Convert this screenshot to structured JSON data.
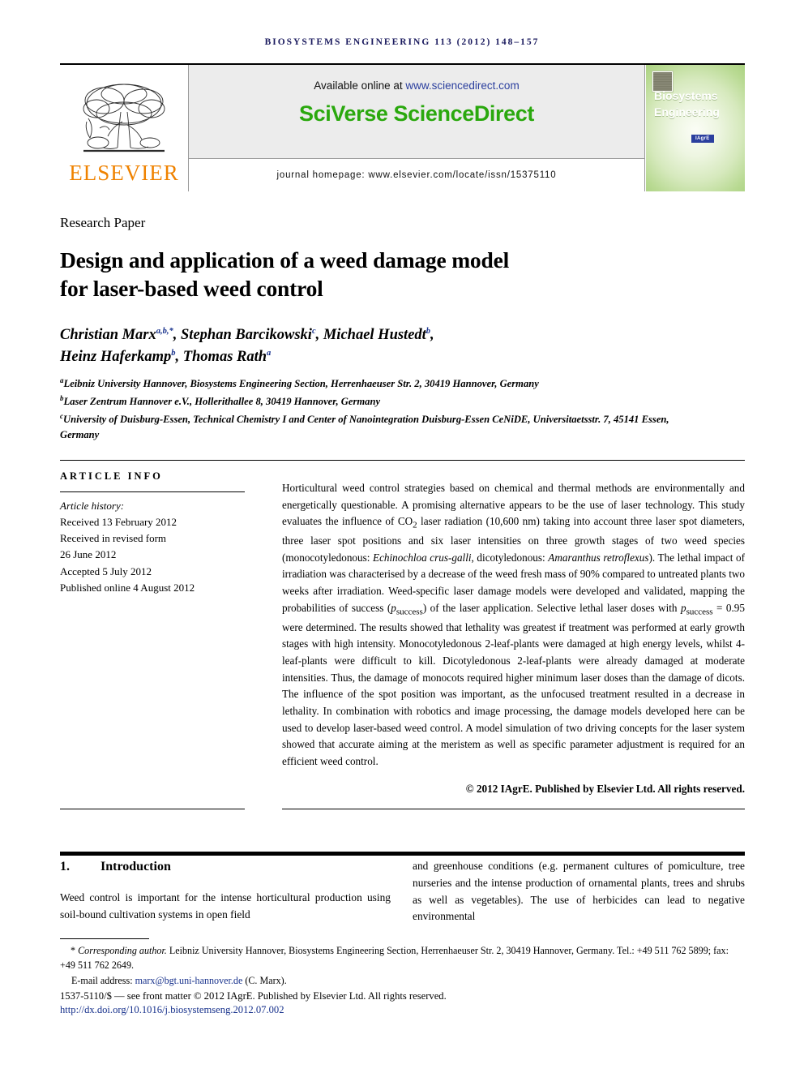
{
  "running_head": "BIOSYSTEMS ENGINEERING 113 (2012) 148–157",
  "masthead": {
    "available_prefix": "Available online at ",
    "sciencedirect_url": "www.sciencedirect.com",
    "brand": "SciVerse ScienceDirect",
    "journal_homepage": "journal homepage: www.elsevier.com/locate/issn/15375110",
    "publisher_name": "ELSEVIER",
    "cover": {
      "title_line1": "Biosystems",
      "title_line2": "Engineering",
      "badge": "IAgrE"
    },
    "colors": {
      "sciverse_green": "#2aa80e",
      "elsevier_orange": "#ef8200",
      "link_blue": "#2b3f9e",
      "banner_grey": "#ececec"
    }
  },
  "article": {
    "section_label": "Research Paper",
    "title_line1": "Design and application of a weed damage model",
    "title_line2": "for laser-based weed control",
    "authors_line1": "Christian Marx",
    "authors_line1_sup1": "a,b,*",
    "authors_line1_b": ", Stephan Barcikowski",
    "authors_line1_sup2": "c",
    "authors_line1_c": ", Michael Hustedt",
    "authors_line1_sup3": "b",
    "authors_line1_d": ",",
    "authors_line2": "Heinz Haferkamp",
    "authors_line2_sup1": "b",
    "authors_line2_b": ", Thomas Rath",
    "authors_line2_sup2": "a",
    "affiliations": [
      {
        "marker": "a",
        "text": "Leibniz University Hannover, Biosystems Engineering Section, Herrenhaeuser Str. 2, 30419 Hannover, Germany"
      },
      {
        "marker": "b",
        "text": "Laser Zentrum Hannover e.V., Hollerithallee 8, 30419 Hannover, Germany"
      },
      {
        "marker": "c",
        "text": "University of Duisburg-Essen, Technical Chemistry I and Center of Nanointegration Duisburg-Essen CeNiDE, Universitaetsstr. 7, 45141 Essen, Germany"
      }
    ]
  },
  "article_info": {
    "heading": "ARTICLE INFO",
    "history_label": "Article history:",
    "history": [
      "Received 13 February 2012",
      "Received in revised form",
      "26 June 2012",
      "Accepted 5 July 2012",
      "Published online 4 August 2012"
    ]
  },
  "abstract": {
    "part1": "Horticultural weed control strategies based on chemical and thermal methods are environmentally and energetically questionable. A promising alternative appears to be the use of laser technology. This study evaluates the influence of CO",
    "co2_sub": "2",
    "part2": " laser radiation (10,600 nm) taking into account three laser spot diameters, three laser spot positions and six laser intensities on three growth stages of two weed species (monocotyledonous: ",
    "species1": "Echinochloa crus-galli",
    "part3": ", dicotyledonous: ",
    "species2": "Amaranthus retroflexus",
    "part4": "). The lethal impact of irradiation was characterised by a decrease of the weed fresh mass of 90% compared to untreated plants two weeks after irradiation. Weed-specific laser damage models were developed and validated, mapping the probabilities of success (",
    "p_symbol1": "p",
    "p_sub1": "success",
    "part5": ") of the laser application. Selective lethal laser doses with ",
    "p_symbol2": "p",
    "p_sub2": "success",
    "part6": " = 0.95 were determined. The results showed that lethality was greatest if treatment was performed at early growth stages with high intensity. Monocotyledonous 2-leaf-plants were damaged at high energy levels, whilst 4-leaf-plants were difficult to kill. Dicotyledonous 2-leaf-plants were already damaged at moderate intensities. Thus, the damage of monocots required higher minimum laser doses than the damage of dicots. The influence of the spot position was important, as the unfocused treatment resulted in a decrease in lethality. In combination with robotics and image processing, the damage models developed here can be used to develop laser-based weed control. A model simulation of two driving concepts for the laser system showed that accurate aiming at the meristem as well as specific parameter adjustment is required for an efficient weed control.",
    "copyright": "© 2012 IAgrE. Published by Elsevier Ltd. All rights reserved."
  },
  "introduction": {
    "number": "1.",
    "heading": "Introduction",
    "column_left": "Weed control is important for the intense horticultural production using soil-bound cultivation systems in open field",
    "column_right": "and greenhouse conditions (e.g. permanent cultures of pomiculture, tree nurseries and the intense production of ornamental plants, trees and shrubs as well as vegetables). The use of herbicides can lead to negative environmental"
  },
  "footnotes": {
    "corresponding_marker": "*",
    "corresponding_label": "Corresponding author.",
    "corresponding_text": " Leibniz University Hannover, Biosystems Engineering Section, Herrenhaeuser Str. 2, 30419 Hannover, Germany. Tel.: +49 511 762 5899; fax: +49 511 762 2649.",
    "email_label": "E-mail address:",
    "email": "marx@bgt.uni-hannover.de",
    "email_suffix": " (C. Marx).",
    "issn_line": "1537-5110/$ — see front matter © 2012 IAgrE. Published by Elsevier Ltd. All rights reserved.",
    "doi": "http://dx.doi.org/10.1016/j.biosystemseng.2012.07.002"
  }
}
